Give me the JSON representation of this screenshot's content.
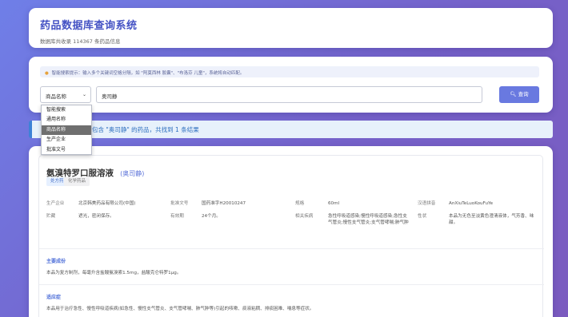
{
  "header": {
    "title": "药品数据库查询系统",
    "subtitle": "数据库共收录 114367 条药品信息"
  },
  "search": {
    "tip": "智能搜索提示：输入多个关键词空格分隔，如 \"阿莫西林 胶囊\"、\"布洛芬 儿童\"，系统将自动匹配。",
    "field_selected": "商品名称",
    "field_options": [
      "智能搜索",
      "通用名称",
      "商品名称",
      "生产企业",
      "批准文号"
    ],
    "query": "奥司静",
    "button_label": "查询"
  },
  "result_banner": "找到包含 \"奥司静\" 的药品，共找到 1 条结果",
  "drug": {
    "name": "氨溴特罗口服溶液",
    "keyword": "(奥司静)",
    "tags": [
      "处方药",
      "化学药品"
    ],
    "info": {
      "manufacturer_label": "生产企业",
      "manufacturer": "北京韩美药品有限公司(中国)",
      "approval_label": "批准文号",
      "approval": "国药准字H20010247",
      "spec_label": "规格",
      "spec": "60ml",
      "pinyin_label": "汉语拼音",
      "pinyin": "AnXiuTeLuoKouFuYe",
      "storage_label": "贮藏",
      "storage": "遮光，密闭保存。",
      "validity_label": "有效期",
      "validity": "24个月。",
      "disease_label": "相关疾病",
      "disease": "急性呼吸道感染;慢性呼吸道感染;急性支气管炎;慢性支气管炎;支气管哮喘;肺气肿",
      "traits_label": "性状",
      "traits": "本品为无色至淡黄色澄清液体，气芳香、味甜。"
    },
    "sections": [
      {
        "title": "主要成份",
        "body": "本品为复方制剂，每毫升含盐酸氨溴索1.5mg，盐酸克仑特罗1μg。"
      },
      {
        "title": "适应症",
        "body": "本品用于治疗急性、慢性呼吸道疾病(如急性、慢性支气管炎、支气管哮喘、肺气肿等)引起的咳嗽、痰液粘稠、排痰困难、喘息等症状。"
      }
    ]
  }
}
